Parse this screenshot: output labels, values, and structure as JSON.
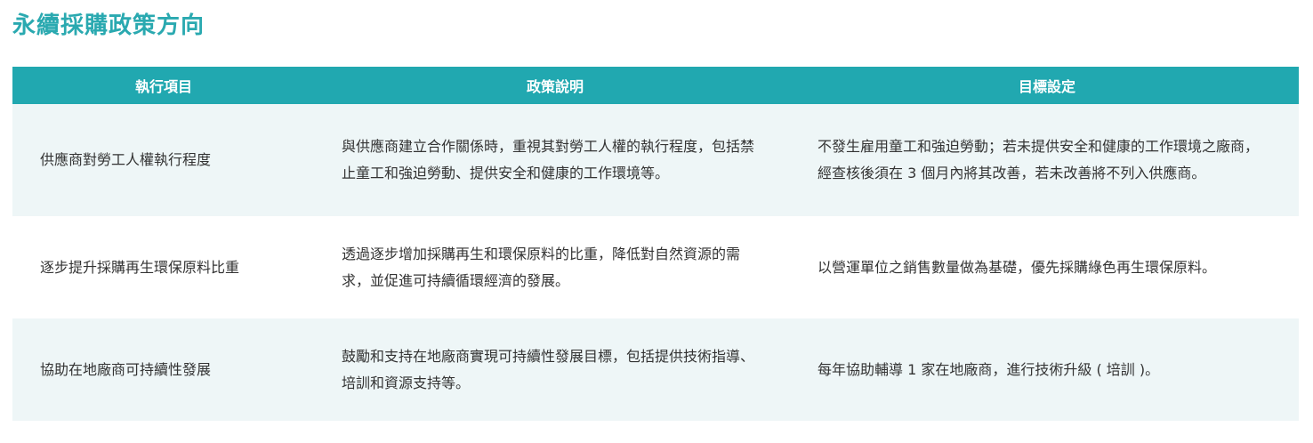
{
  "page": {
    "title": "永續採購政策方向"
  },
  "table": {
    "headers": [
      "執行項目",
      "政策說明",
      "目標設定"
    ],
    "rows": [
      {
        "item": "供應商對勞工人權執行程度",
        "description": "與供應商建立合作關係時，重視其對勞工人權的執行程度，包括禁止童工和強迫勞動、提供安全和健康的工作環境等。",
        "target": "不發生雇用童工和強迫勞動；若未提供安全和健康的工作環境之廠商，經查核後須在 3 個月內將其改善，若未改善將不列入供應商。"
      },
      {
        "item": "逐步提升採購再生環保原料比重",
        "description": "透過逐步增加採購再生和環保原料的比重，降低對自然資源的需求，並促進可持續循環經濟的發展。",
        "target": "以營運單位之銷售數量做為基礎，優先採購綠色再生環保原料。"
      },
      {
        "item": "協助在地廠商可持續性發展",
        "description": "鼓勵和支持在地廠商實現可持續性發展目標，包括提供技術指導、培訓和資源支持等。",
        "target": "每年協助輔導 1 家在地廠商，進行技術升級 ( 培訓 )。"
      }
    ]
  },
  "colors": {
    "title": "#2aa9b0",
    "header_bg": "#21a8b0",
    "header_text": "#ffffff",
    "row_shade": "#eef6f7",
    "body_text": "#333333"
  }
}
